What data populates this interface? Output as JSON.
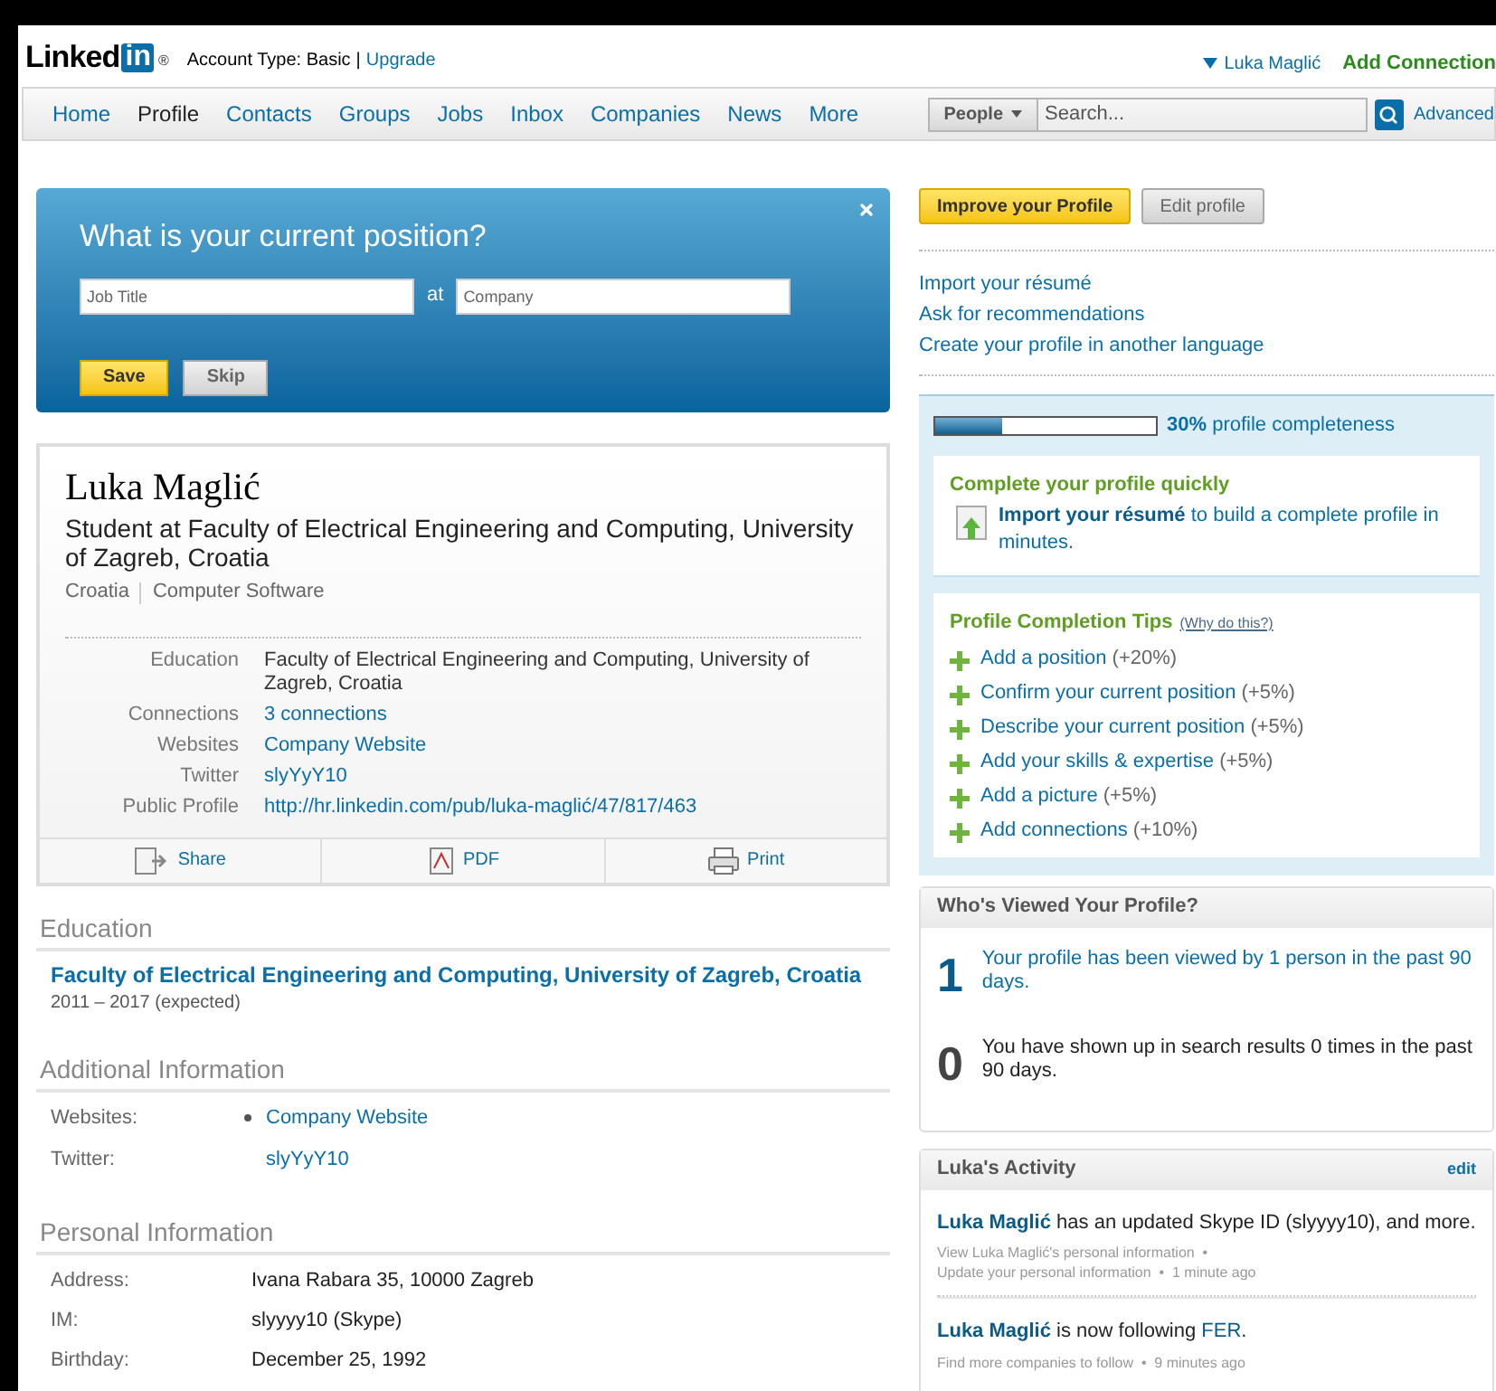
{
  "header": {
    "logo": {
      "text": "Linked",
      "box": "in",
      "mark": "®"
    },
    "account_label": "Account Type: Basic",
    "separator": "|",
    "upgrade": "Upgrade",
    "user": "Luka Maglić",
    "add_connection": "Add Connection"
  },
  "nav": {
    "items": [
      {
        "label": "Home",
        "selected": false
      },
      {
        "label": "Profile",
        "selected": true
      },
      {
        "label": "Contacts",
        "selected": false
      },
      {
        "label": "Groups",
        "selected": false
      },
      {
        "label": "Jobs",
        "selected": false
      },
      {
        "label": "Inbox",
        "selected": false
      },
      {
        "label": "Companies",
        "selected": false
      },
      {
        "label": "News",
        "selected": false
      },
      {
        "label": "More",
        "selected": false
      }
    ],
    "search_scope": "People",
    "search": {
      "placeholder": "Search..."
    },
    "advanced": "Advanced"
  },
  "position_prompt": {
    "title": "What is your current position?",
    "job_title": {
      "placeholder": "Job Title"
    },
    "at": "at",
    "company": {
      "placeholder": "Company"
    },
    "buttons": [
      "Save",
      "Skip"
    ]
  },
  "profile_card": {
    "name": "Luka Maglić",
    "headline": "Student at Faculty of Electrical Engineering and Computing, University of Zagreb, Croatia",
    "location": "Croatia",
    "industry": "Computer Software",
    "fields": [
      {
        "label": "Education",
        "value": "Faculty of Electrical Engineering and Computing, University of Zagreb, Croatia",
        "kind": "text"
      },
      {
        "label": "Connections",
        "value": "3 connections",
        "kind": "link"
      },
      {
        "label": "Websites",
        "value": "Company Website",
        "kind": "link"
      },
      {
        "label": "Twitter",
        "value": "slyYyY10",
        "kind": "link"
      },
      {
        "label": "Public Profile",
        "value": "http://hr.linkedin.com/pub/luka-maglić/47/817/463",
        "kind": "link"
      }
    ],
    "actions": [
      {
        "label": "Share",
        "kind": "share"
      },
      {
        "label": "PDF",
        "kind": "pdf"
      },
      {
        "label": "Print",
        "kind": "print"
      }
    ]
  },
  "education": {
    "heading": "Education",
    "school": "Faculty of Electrical Engineering and Computing, University of Zagreb, Croatia",
    "dates": "2011 – 2017 (expected)"
  },
  "additional_info": {
    "heading": "Additional Information",
    "rows": [
      {
        "label": "Websites:",
        "value": "Company Website",
        "bullet": true
      },
      {
        "label": "Twitter:",
        "value": "slyYyY10",
        "bullet": false
      }
    ]
  },
  "personal_info": {
    "heading": "Personal Information",
    "rows": [
      {
        "label": "Address:",
        "value": "Ivana Rabara 35, 10000 Zagreb"
      },
      {
        "label": "IM:",
        "value": "slyyyy10 (Skype)"
      },
      {
        "label": "Birthday:",
        "value": "December 25, 1992"
      }
    ]
  },
  "sidebar": {
    "buttons": [
      "Improve your Profile",
      "Edit profile"
    ],
    "links": [
      "Import your résumé",
      "Ask for recommendations",
      "Create your profile in another language"
    ],
    "completeness": {
      "level": 0.3,
      "percent": "30%",
      "label": "profile completeness"
    },
    "quick": {
      "title": "Complete your profile quickly",
      "link": "Import your résumé",
      "text": "to build a complete profile in minutes."
    },
    "tips": {
      "title": "Profile Completion Tips",
      "why": "(Why do this?)",
      "items": [
        {
          "label": "Add a position",
          "gain": "(+20%)"
        },
        {
          "label": "Confirm your current position",
          "gain": "(+5%)"
        },
        {
          "label": "Describe your current position",
          "gain": "(+5%)"
        },
        {
          "label": "Add your skills & expertise",
          "gain": "(+5%)"
        },
        {
          "label": "Add a picture",
          "gain": "(+5%)"
        },
        {
          "label": "Add connections",
          "gain": "(+10%)"
        }
      ]
    }
  },
  "viewed": {
    "title": "Who's Viewed Your Profile?",
    "stats": [
      {
        "count": "1",
        "text": "Your profile has been viewed by 1 person in the past 90 days.",
        "kind": "link"
      },
      {
        "count": "0",
        "text": "You have shown up in search results 0 times in the past 90 days.",
        "kind": "text"
      }
    ]
  },
  "activity": {
    "title": "Luka's Activity",
    "edit": "edit",
    "items": [
      {
        "actor": "Luka Maglić",
        "text": "has an updated Skype ID (slyyyy10), and more.",
        "meta": [
          "View Luka Maglić's personal information  •",
          "Update your personal information  •  1 minute ago"
        ]
      },
      {
        "actor": "Luka Maglić",
        "text": "is now following",
        "target": "FER",
        "end": ".",
        "meta": [
          "Find more companies to follow  •  9 minutes ago"
        ]
      }
    ]
  }
}
